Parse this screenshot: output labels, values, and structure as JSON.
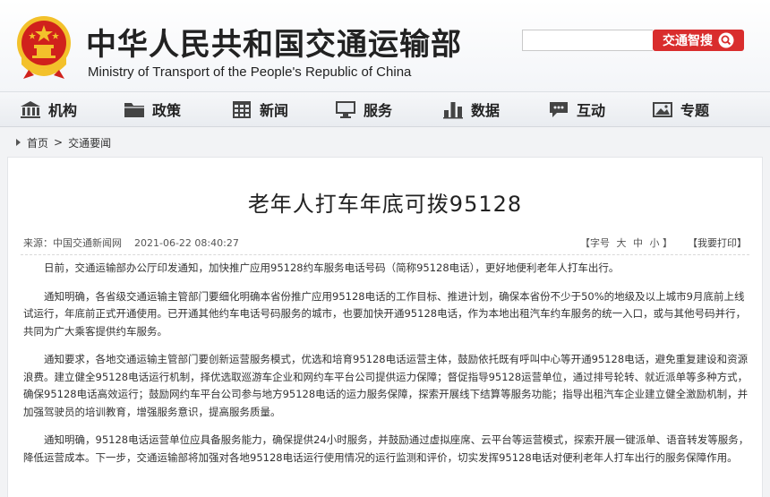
{
  "header": {
    "site_name_cn": "中华人民共和国交通运输部",
    "site_name_en": "Ministry of Transport of the People's Republic of China",
    "search": {
      "placeholder": "",
      "button_label": "交通智搜"
    }
  },
  "nav": {
    "items": [
      {
        "label": "机构",
        "icon": "building-icon"
      },
      {
        "label": "政策",
        "icon": "folder-icon"
      },
      {
        "label": "新闻",
        "icon": "calendar-grid-icon"
      },
      {
        "label": "服务",
        "icon": "monitor-icon"
      },
      {
        "label": "数据",
        "icon": "bar-chart-icon"
      },
      {
        "label": "互动",
        "icon": "chat-bubble-icon"
      },
      {
        "label": "专题",
        "icon": "picture-icon"
      }
    ]
  },
  "breadcrumb": {
    "home": "首页",
    "separator": ">",
    "current": "交通要闻"
  },
  "article": {
    "title": "老年人打车年底可拨95128",
    "source": "来源：中国交通新闻网",
    "date": "2021-06-22 08:40:27",
    "font_size_label": "【字号",
    "font_size_options": [
      "大",
      "中",
      "小"
    ],
    "font_size_close": "】",
    "print_label": "【我要打印】",
    "paragraphs": [
      "日前，交通运输部办公厅印发通知，加快推广应用95128约车服务电话号码（简称95128电话），更好地便利老年人打车出行。",
      "通知明确，各省级交通运输主管部门要细化明确本省份推广应用95128电话的工作目标、推进计划，确保本省份不少于50%的地级及以上城市9月底前上线试运行，年底前正式开通使用。已开通其他约车电话号码服务的城市，也要加快开通95128电话，作为本地出租汽车约车服务的统一入口，或与其他号码并行，共同为广大乘客提供约车服务。",
      "通知要求，各地交通运输主管部门要创新运营服务模式，优选和培育95128电话运营主体，鼓励依托既有呼叫中心等开通95128电话，避免重复建设和资源浪费。建立健全95128电话运行机制，择优选取巡游车企业和网约车平台公司提供运力保障；督促指导95128运营单位，通过排号轮转、就近派单等多种方式，确保95128电话高效运行；鼓励网约车平台公司参与地方95128电话的运力服务保障，探索开展线下结算等服务功能；指导出租汽车企业建立健全激励机制，并加强驾驶员的培训教育，增强服务意识，提高服务质量。",
      "通知明确，95128电话运营单位应具备服务能力，确保提供24小时服务，并鼓励通过虚拟座席、云平台等运营模式，探索开展一键派单、语音转发等服务，降低运营成本。下一步，交通运输部将加强对各地95128电话运行使用情况的运行监测和评价，切实发挥95128电话对便利老年人打车出行的服务保障作用。"
    ]
  },
  "colors": {
    "brand_red": "#d92d2d",
    "emblem_red": "#d0211c",
    "emblem_gold": "#f3c12b"
  }
}
